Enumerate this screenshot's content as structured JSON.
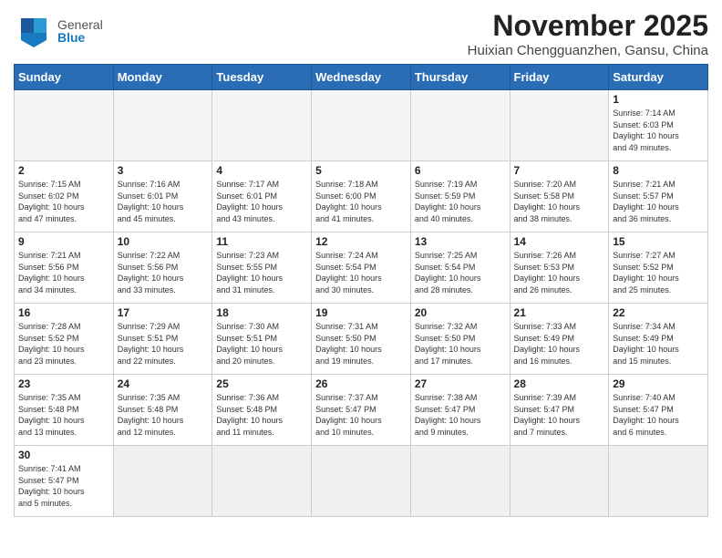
{
  "logo": {
    "general": "General",
    "blue": "Blue"
  },
  "header": {
    "month": "November 2025",
    "location": "Huixian Chengguanzhen, Gansu, China"
  },
  "weekdays": [
    "Sunday",
    "Monday",
    "Tuesday",
    "Wednesday",
    "Thursday",
    "Friday",
    "Saturday"
  ],
  "weeks": [
    [
      {
        "day": "",
        "info": ""
      },
      {
        "day": "",
        "info": ""
      },
      {
        "day": "",
        "info": ""
      },
      {
        "day": "",
        "info": ""
      },
      {
        "day": "",
        "info": ""
      },
      {
        "day": "",
        "info": ""
      },
      {
        "day": "1",
        "info": "Sunrise: 7:14 AM\nSunset: 6:03 PM\nDaylight: 10 hours\nand 49 minutes."
      }
    ],
    [
      {
        "day": "2",
        "info": "Sunrise: 7:15 AM\nSunset: 6:02 PM\nDaylight: 10 hours\nand 47 minutes."
      },
      {
        "day": "3",
        "info": "Sunrise: 7:16 AM\nSunset: 6:01 PM\nDaylight: 10 hours\nand 45 minutes."
      },
      {
        "day": "4",
        "info": "Sunrise: 7:17 AM\nSunset: 6:01 PM\nDaylight: 10 hours\nand 43 minutes."
      },
      {
        "day": "5",
        "info": "Sunrise: 7:18 AM\nSunset: 6:00 PM\nDaylight: 10 hours\nand 41 minutes."
      },
      {
        "day": "6",
        "info": "Sunrise: 7:19 AM\nSunset: 5:59 PM\nDaylight: 10 hours\nand 40 minutes."
      },
      {
        "day": "7",
        "info": "Sunrise: 7:20 AM\nSunset: 5:58 PM\nDaylight: 10 hours\nand 38 minutes."
      },
      {
        "day": "8",
        "info": "Sunrise: 7:21 AM\nSunset: 5:57 PM\nDaylight: 10 hours\nand 36 minutes."
      }
    ],
    [
      {
        "day": "9",
        "info": "Sunrise: 7:21 AM\nSunset: 5:56 PM\nDaylight: 10 hours\nand 34 minutes."
      },
      {
        "day": "10",
        "info": "Sunrise: 7:22 AM\nSunset: 5:56 PM\nDaylight: 10 hours\nand 33 minutes."
      },
      {
        "day": "11",
        "info": "Sunrise: 7:23 AM\nSunset: 5:55 PM\nDaylight: 10 hours\nand 31 minutes."
      },
      {
        "day": "12",
        "info": "Sunrise: 7:24 AM\nSunset: 5:54 PM\nDaylight: 10 hours\nand 30 minutes."
      },
      {
        "day": "13",
        "info": "Sunrise: 7:25 AM\nSunset: 5:54 PM\nDaylight: 10 hours\nand 28 minutes."
      },
      {
        "day": "14",
        "info": "Sunrise: 7:26 AM\nSunset: 5:53 PM\nDaylight: 10 hours\nand 26 minutes."
      },
      {
        "day": "15",
        "info": "Sunrise: 7:27 AM\nSunset: 5:52 PM\nDaylight: 10 hours\nand 25 minutes."
      }
    ],
    [
      {
        "day": "16",
        "info": "Sunrise: 7:28 AM\nSunset: 5:52 PM\nDaylight: 10 hours\nand 23 minutes."
      },
      {
        "day": "17",
        "info": "Sunrise: 7:29 AM\nSunset: 5:51 PM\nDaylight: 10 hours\nand 22 minutes."
      },
      {
        "day": "18",
        "info": "Sunrise: 7:30 AM\nSunset: 5:51 PM\nDaylight: 10 hours\nand 20 minutes."
      },
      {
        "day": "19",
        "info": "Sunrise: 7:31 AM\nSunset: 5:50 PM\nDaylight: 10 hours\nand 19 minutes."
      },
      {
        "day": "20",
        "info": "Sunrise: 7:32 AM\nSunset: 5:50 PM\nDaylight: 10 hours\nand 17 minutes."
      },
      {
        "day": "21",
        "info": "Sunrise: 7:33 AM\nSunset: 5:49 PM\nDaylight: 10 hours\nand 16 minutes."
      },
      {
        "day": "22",
        "info": "Sunrise: 7:34 AM\nSunset: 5:49 PM\nDaylight: 10 hours\nand 15 minutes."
      }
    ],
    [
      {
        "day": "23",
        "info": "Sunrise: 7:35 AM\nSunset: 5:48 PM\nDaylight: 10 hours\nand 13 minutes."
      },
      {
        "day": "24",
        "info": "Sunrise: 7:35 AM\nSunset: 5:48 PM\nDaylight: 10 hours\nand 12 minutes."
      },
      {
        "day": "25",
        "info": "Sunrise: 7:36 AM\nSunset: 5:48 PM\nDaylight: 10 hours\nand 11 minutes."
      },
      {
        "day": "26",
        "info": "Sunrise: 7:37 AM\nSunset: 5:47 PM\nDaylight: 10 hours\nand 10 minutes."
      },
      {
        "day": "27",
        "info": "Sunrise: 7:38 AM\nSunset: 5:47 PM\nDaylight: 10 hours\nand 9 minutes."
      },
      {
        "day": "28",
        "info": "Sunrise: 7:39 AM\nSunset: 5:47 PM\nDaylight: 10 hours\nand 7 minutes."
      },
      {
        "day": "29",
        "info": "Sunrise: 7:40 AM\nSunset: 5:47 PM\nDaylight: 10 hours\nand 6 minutes."
      }
    ],
    [
      {
        "day": "30",
        "info": "Sunrise: 7:41 AM\nSunset: 5:47 PM\nDaylight: 10 hours\nand 5 minutes."
      },
      {
        "day": "",
        "info": ""
      },
      {
        "day": "",
        "info": ""
      },
      {
        "day": "",
        "info": ""
      },
      {
        "day": "",
        "info": ""
      },
      {
        "day": "",
        "info": ""
      },
      {
        "day": "",
        "info": ""
      }
    ]
  ]
}
